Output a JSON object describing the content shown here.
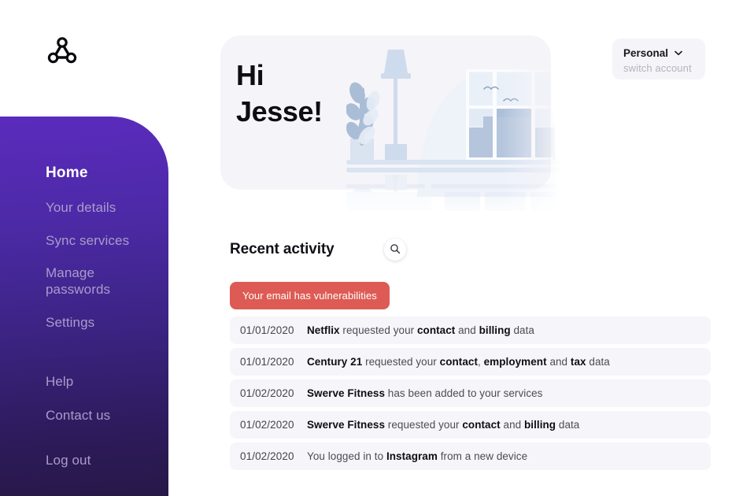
{
  "brand": {
    "logo_icon": "share-nodes-logo-icon",
    "sidebar_gradient_top": "#5b2bbd",
    "sidebar_gradient_bottom": "#271848",
    "accent_alert": "#dd5b54",
    "card_bg": "#f5f4f9",
    "row_bg": "#f6f5fa"
  },
  "sidebar": {
    "items": [
      {
        "label": "Home",
        "active": true
      },
      {
        "label": "Your details",
        "active": false
      },
      {
        "label": "Sync services",
        "active": false
      },
      {
        "label": "Manage passwords",
        "active": false
      },
      {
        "label": "Settings",
        "active": false
      },
      {
        "label": "Help",
        "active": false
      },
      {
        "label": "Contact us",
        "active": false
      },
      {
        "label": "Log out",
        "active": false
      }
    ]
  },
  "hero": {
    "greeting_line1": "Hi",
    "greeting_line2": "Jesse!",
    "illustration": "living-room-window-lamp-plant-illustration"
  },
  "account": {
    "name": "Personal",
    "caret_icon": "chevron-down-icon",
    "switch_label": "switch account"
  },
  "activity": {
    "title": "Recent activity",
    "search_icon": "search-icon",
    "alert": "Your email has vulnerabilities",
    "rows": [
      {
        "date": "01/01/2020",
        "parts": [
          {
            "text": "Netflix",
            "bold": true
          },
          {
            "text": " requested your ",
            "bold": false
          },
          {
            "text": "contact",
            "bold": true
          },
          {
            "text": " and ",
            "bold": false
          },
          {
            "text": "billing",
            "bold": true
          },
          {
            "text": " data",
            "bold": false
          }
        ]
      },
      {
        "date": "01/01/2020",
        "parts": [
          {
            "text": "Century 21",
            "bold": true
          },
          {
            "text": " requested your ",
            "bold": false
          },
          {
            "text": "contact",
            "bold": true
          },
          {
            "text": ", ",
            "bold": false
          },
          {
            "text": "employment",
            "bold": true
          },
          {
            "text": " and ",
            "bold": false
          },
          {
            "text": "tax",
            "bold": true
          },
          {
            "text": " data",
            "bold": false
          }
        ]
      },
      {
        "date": "01/02/2020",
        "parts": [
          {
            "text": "Swerve Fitness",
            "bold": true
          },
          {
            "text": " has been added to your services",
            "bold": false
          }
        ]
      },
      {
        "date": "01/02/2020",
        "parts": [
          {
            "text": "Swerve Fitness",
            "bold": true
          },
          {
            "text": " requested your ",
            "bold": false
          },
          {
            "text": "contact",
            "bold": true
          },
          {
            "text": " and ",
            "bold": false
          },
          {
            "text": "billing",
            "bold": true
          },
          {
            "text": " data",
            "bold": false
          }
        ]
      },
      {
        "date": "01/02/2020",
        "parts": [
          {
            "text": "You logged in to ",
            "bold": false
          },
          {
            "text": "Instagram",
            "bold": true
          },
          {
            "text": " from a new device",
            "bold": false
          }
        ]
      }
    ]
  }
}
